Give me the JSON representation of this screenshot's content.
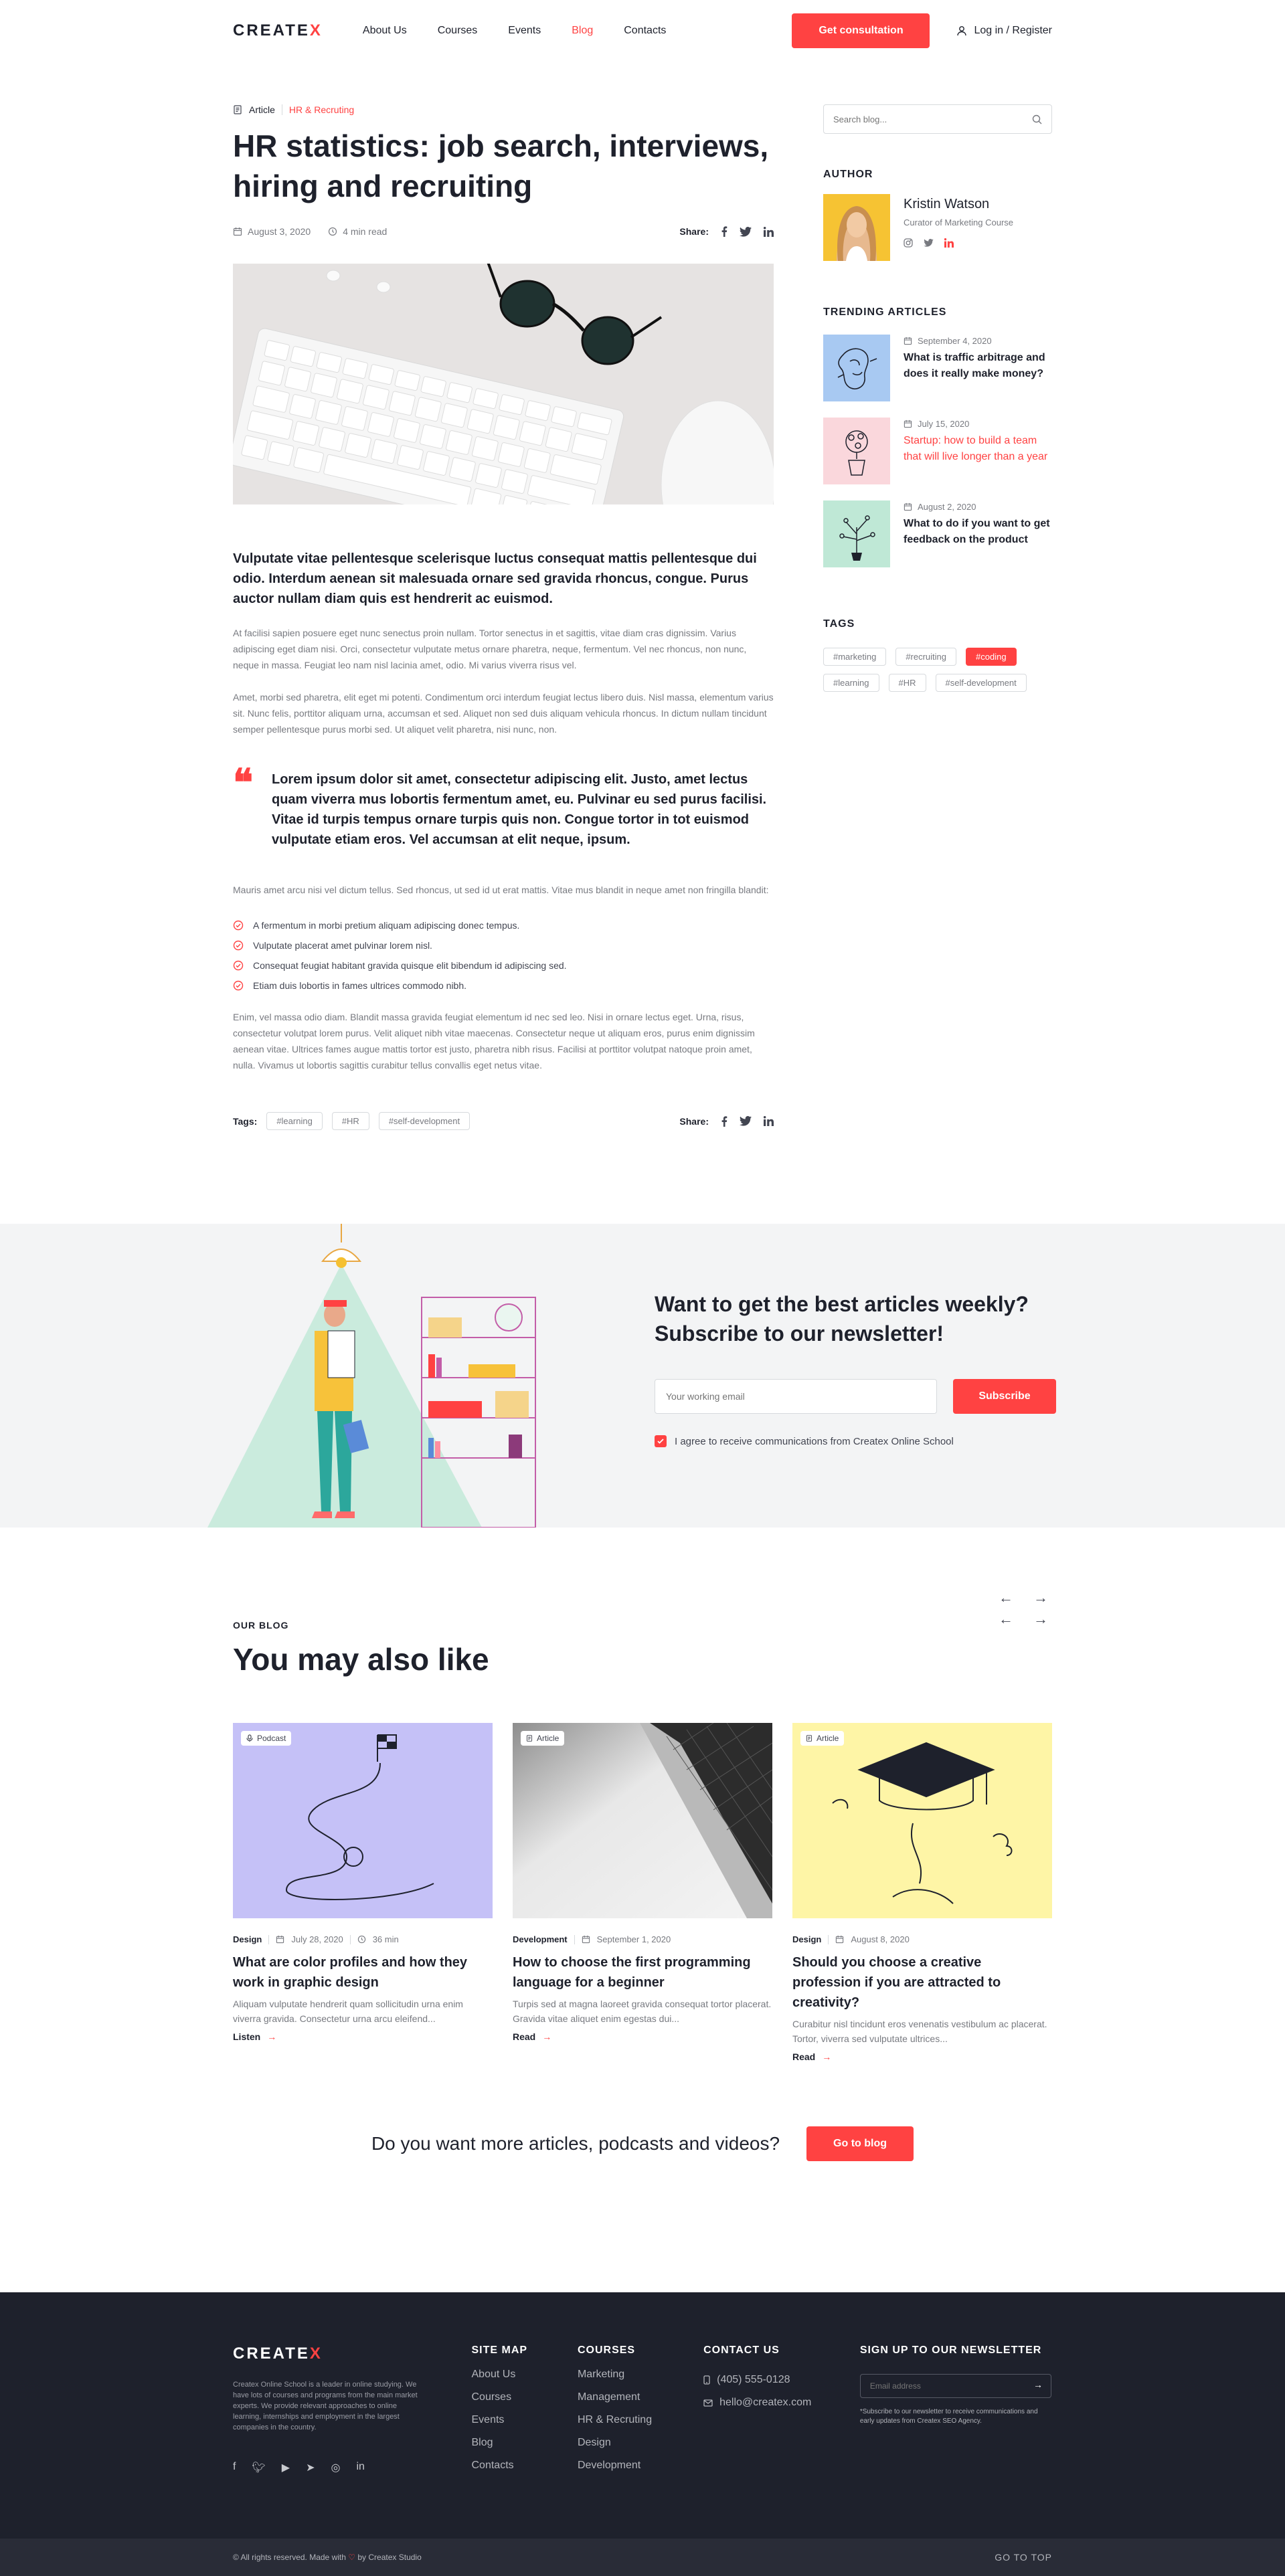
{
  "brand": {
    "logo_main": "CREATE",
    "logo_x": "X",
    "accent": "#FF4242",
    "dark": "#1E212C"
  },
  "nav": {
    "items": [
      "About Us",
      "Courses",
      "Events",
      "Blog",
      "Contacts"
    ],
    "active": "Blog"
  },
  "header": {
    "cta": "Get consultation",
    "login": "Log in / Register"
  },
  "article": {
    "type": "Article",
    "category": "HR & Recruting",
    "title": "HR statistics: job search,  interviews, hiring and recruiting",
    "date": "August 3, 2020",
    "read_time": "4 min read",
    "share_label": "Share:",
    "lead": "Vulputate vitae pellentesque scelerisque luctus consequat mattis pellentesque dui odio. Interdum aenean sit malesuada ornare sed gravida rhoncus, congue. Purus auctor nullam diam quis est hendrerit ac euismod.",
    "p1": "At facilisi sapien posuere eget nunc senectus proin nullam. Tortor senectus in et sagittis, vitae diam cras dignissim. Varius adipiscing eget diam nisi. Orci, consectetur vulputate metus ornare pharetra, neque, fermentum. Vel nec rhoncus, non nunc, neque in massa. Feugiat leo nam nisl lacinia amet, odio. Mi varius viverra risus vel.",
    "p2": "Amet, morbi sed pharetra, elit eget mi potenti. Condimentum orci interdum feugiat lectus libero duis. Nisl massa, elementum varius sit. Nunc felis, porttitor aliquam urna, accumsan et sed. Aliquet non sed duis aliquam vehicula rhoncus. In dictum nullam tincidunt semper pellentesque purus morbi sed. Ut aliquet velit pharetra, nisi nunc, non.",
    "quote": "Lorem ipsum dolor sit amet, consectetur adipiscing elit. Justo, amet lectus quam viverra mus lobortis fermentum amet, eu. Pulvinar eu sed purus  facilisi. Vitae id turpis tempus ornare turpis quis non. Congue tortor in tot euismod vulputate etiam eros. Vel accumsan at elit neque, ipsum.",
    "p3": "Mauris amet arcu nisi vel dictum tellus. Sed rhoncus, ut sed id ut erat mattis. Vitae mus blandit in neque amet non fringilla blandit:",
    "checklist": [
      "A fermentum in morbi pretium aliquam adipiscing donec tempus.",
      "Vulputate placerat amet pulvinar lorem nisl.",
      "Consequat feugiat habitant gravida quisque elit bibendum id adipiscing sed.",
      "Etiam duis lobortis in fames ultrices commodo nibh."
    ],
    "p4": "Enim, vel massa odio diam. Blandit massa gravida feugiat elementum id nec sed leo. Nisi in ornare lectus eget. Urna, risus, consectetur volutpat lorem purus. Velit aliquet nibh vitae maecenas. Consectetur neque ut aliquam eros, purus enim dignissim aenean vitae. Ultrices fames augue mattis tortor est justo, pharetra nibh risus. Facilisi at porttitor volutpat natoque proin amet, nulla. Vivamus ut lobortis sagittis curabitur tellus convallis eget netus vitae.",
    "tags_label": "Tags:",
    "tags": [
      "#learning",
      "#HR",
      "#self-development"
    ]
  },
  "sidebar": {
    "search_placeholder": "Search blog...",
    "author_heading": "AUTHOR",
    "author_name": "Kristin Watson",
    "author_role": "Curator of Marketing Course",
    "trending_heading": "TRENDING ARTICLES",
    "trending": [
      {
        "date": "September 4, 2020",
        "title": "What is traffic arbitrage and does it really make money?",
        "hover": false
      },
      {
        "date": "July 15, 2020",
        "title": "Startup: how to build a team that will live longer than a year",
        "hover": true
      },
      {
        "date": "August 2, 2020",
        "title": "What to do if you want to get feedback on the product",
        "hover": false
      }
    ],
    "tags_heading": "TAGS",
    "tags": [
      {
        "label": "#marketing",
        "active": false
      },
      {
        "label": "#recruiting",
        "active": false
      },
      {
        "label": "#coding",
        "active": true
      },
      {
        "label": "#learning",
        "active": false
      },
      {
        "label": "#HR",
        "active": false
      },
      {
        "label": "#self-development",
        "active": false
      }
    ]
  },
  "newsletter": {
    "heading": "Want to get the best articles weekly? Subscribe to our newsletter!",
    "placeholder": "Your working email",
    "button": "Subscribe",
    "agree": "I agree to receive communications from Createx Online School"
  },
  "blog": {
    "eyebrow": "OUR BLOG",
    "heading": "You may also like",
    "cards": [
      {
        "badge": "Podcast",
        "category": "Design",
        "date": "July 28, 2020",
        "duration": "36 min",
        "title": "What are color profiles and how they work in graphic design",
        "desc": "Aliquam vulputate hendrerit quam sollicitudin urna enim viverra gravida. Consectetur urna arcu eleifend...",
        "link": "Listen"
      },
      {
        "badge": "Article",
        "category": "Development",
        "date": "September 1, 2020",
        "duration": "",
        "title": "How to choose the first programming language for a beginner",
        "desc": "Turpis sed at magna laoreet gravida consequat tortor placerat. Gravida vitae aliquet enim egestas dui...",
        "link": "Read"
      },
      {
        "badge": "Article",
        "category": "Design",
        "date": "August 8, 2020",
        "duration": "",
        "title": "Should you choose a creative profession if you are attracted to creativity?",
        "desc": "Curabitur nisl tincidunt eros venenatis vestibulum ac placerat. Tortor, viverra sed vulputate ultrices...",
        "link": "Read"
      }
    ],
    "more_text": "Do you want more articles, podcasts and videos?",
    "more_button": "Go to blog"
  },
  "footer": {
    "about": "Createx Online School is a leader in online studying. We have lots of courses and programs from the main market experts. We provide relevant approaches to online learning, internships and employment in the largest companies in the country.",
    "sitemap_heading": "SITE MAP",
    "sitemap": [
      "About Us",
      "Courses",
      "Events",
      "Blog",
      "Contacts"
    ],
    "courses_heading": "COURSES",
    "courses": [
      "Marketing",
      "Management",
      "HR & Recruting",
      "Design",
      "Development"
    ],
    "contact_heading": "CONTACT US",
    "phone": "(405) 555-0128",
    "email": "hello@createx.com",
    "news_heading": "SIGN UP TO OUR NEWSLETTER",
    "news_placeholder": "Email address",
    "news_note": "*Subscribe to our newsletter to receive communications and early updates from Createx SEO Agency.",
    "copyright_pre": "© All rights reserved. Made with",
    "copyright_post": "by Createx Studio",
    "gotop": "GO TO TOP"
  }
}
